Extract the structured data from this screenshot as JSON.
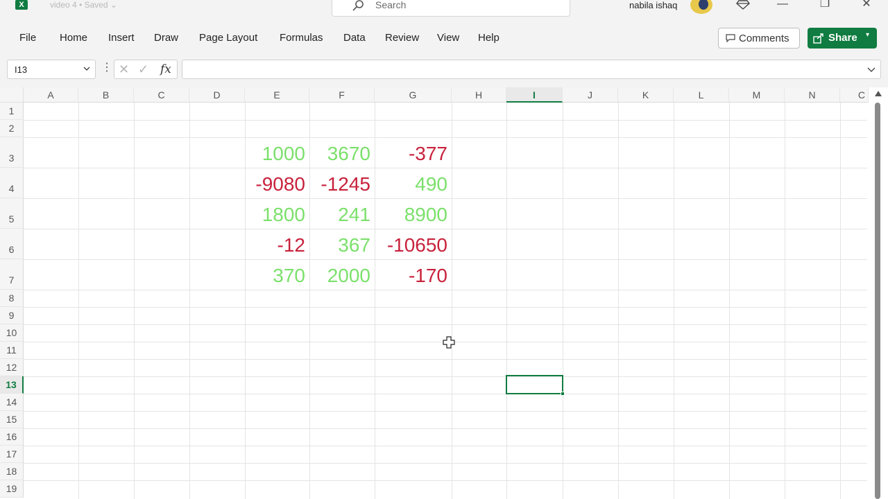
{
  "titlebar": {
    "app_badge": "X",
    "doc_title": "video 4 • Saved ⌄",
    "search_placeholder": "Search",
    "username": "nabila ishaq",
    "minimize": "—",
    "restore": "❐",
    "close": "✕"
  },
  "menu": {
    "items": [
      "File",
      "Home",
      "Insert",
      "Draw",
      "Page Layout",
      "Formulas",
      "Data",
      "Review",
      "View",
      "Help"
    ],
    "comments_label": "Comments",
    "share_label": "Share",
    "share_caret": "▾"
  },
  "formula_bar": {
    "name_box": "I13",
    "dots": "⋮",
    "cancel": "✕",
    "enter": "✓",
    "fx": "fx",
    "formula_value": ""
  },
  "grid": {
    "columns": [
      "A",
      "B",
      "C",
      "D",
      "E",
      "F",
      "G",
      "H",
      "I",
      "J",
      "K",
      "L",
      "M",
      "N",
      "C"
    ],
    "rows": [
      "1",
      "2",
      "3",
      "4",
      "5",
      "6",
      "7",
      "8",
      "9",
      "10",
      "11",
      "12",
      "13",
      "14",
      "15",
      "16",
      "17",
      "18",
      "19"
    ],
    "selected_cell": "I13",
    "colors": {
      "positive": "#7be06b",
      "negative": "#c8223c",
      "accent": "#107c41"
    },
    "data_rows": [
      [
        "1000",
        "3670",
        "-377"
      ],
      [
        "-9080",
        "-1245",
        "490"
      ],
      [
        "1800",
        "241",
        "8900"
      ],
      [
        "-12",
        "367",
        "-10650"
      ],
      [
        "370",
        "2000",
        "-170"
      ]
    ]
  }
}
